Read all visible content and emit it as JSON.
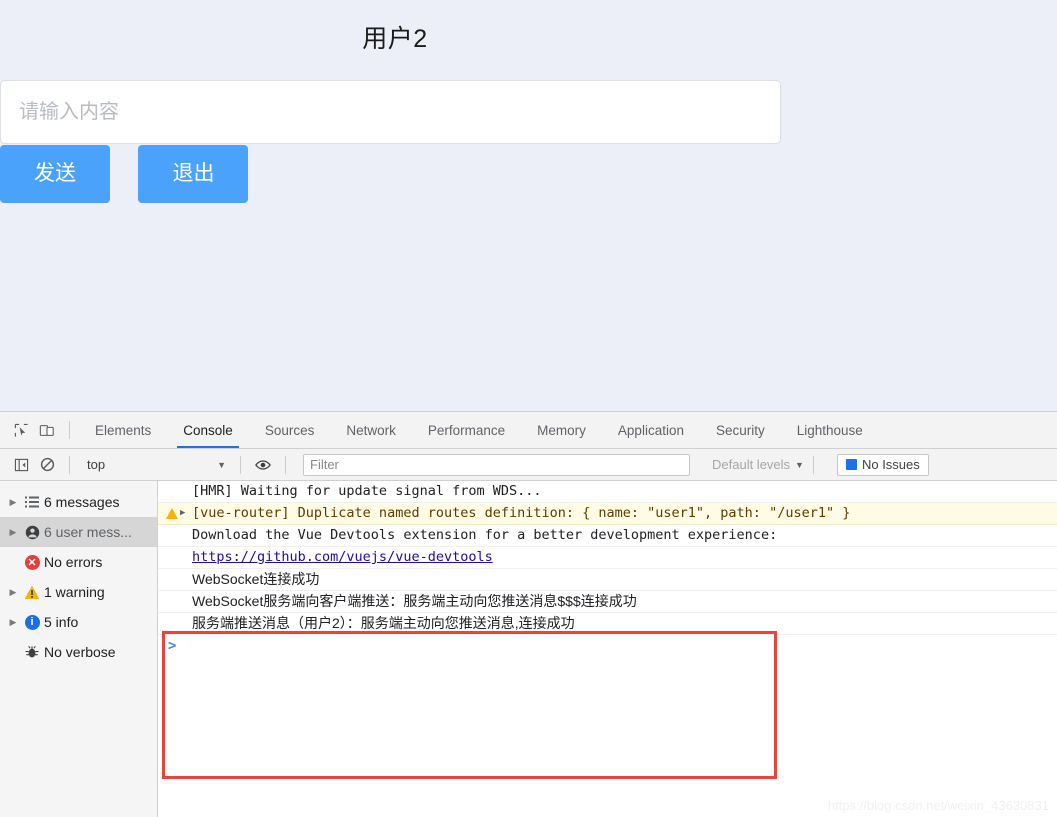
{
  "app": {
    "title": "用户2",
    "input": {
      "value": "",
      "placeholder": "请输入内容"
    },
    "send_label": "发送",
    "quit_label": "退出",
    "background_color": "#eceff8",
    "button_color": "#4ba2fb"
  },
  "devtools": {
    "icons": {
      "inspect": "inspect-cursor-icon",
      "device": "device-toolbar-icon"
    },
    "tabs": [
      {
        "label": "Elements",
        "active": false
      },
      {
        "label": "Console",
        "active": true
      },
      {
        "label": "Sources",
        "active": false
      },
      {
        "label": "Network",
        "active": false
      },
      {
        "label": "Performance",
        "active": false
      },
      {
        "label": "Memory",
        "active": false
      },
      {
        "label": "Application",
        "active": false
      },
      {
        "label": "Security",
        "active": false
      },
      {
        "label": "Lighthouse",
        "active": false
      }
    ],
    "filterbar": {
      "context": "top",
      "caret": "▼",
      "filter_placeholder": "Filter",
      "filter_value": "",
      "levels_label": "Default levels",
      "levels_caret": "▼",
      "issues_label": "No Issues",
      "eye_icon": "eye-icon",
      "sidebar_toggle_icon": "sidebar-toggle-icon",
      "clear_icon": "clear-console-icon"
    },
    "sidebar": [
      {
        "label": "6 messages",
        "icon": "list-icon",
        "tri": "▶",
        "selected": false
      },
      {
        "label": "6 user mess...",
        "icon": "user-icon",
        "tri": "▶",
        "selected": true
      },
      {
        "label": "No errors",
        "icon": "error-icon",
        "tri": "",
        "selected": false
      },
      {
        "label": "1 warning",
        "icon": "warning-icon",
        "tri": "▶",
        "selected": false
      },
      {
        "label": "5 info",
        "icon": "info-icon",
        "tri": "▶",
        "selected": false
      },
      {
        "label": "No verbose",
        "icon": "bug-icon",
        "tri": "",
        "selected": false
      }
    ],
    "messages": [
      {
        "text": "[HMR] Waiting for update signal from WDS...",
        "level": "log",
        "zh": false
      },
      {
        "text": "[vue-router] Duplicate named routes definition: { name: \"user1\", path: \"/user1\" }",
        "level": "warning",
        "zh": false,
        "disclosure": "▶"
      },
      {
        "text": "Download the Vue Devtools extension for a better development experience:",
        "level": "log",
        "zh": false
      },
      {
        "text": "https://github.com/vuejs/vue-devtools",
        "level": "log",
        "zh": false,
        "is_link": true
      },
      {
        "text": "WebSocket连接成功",
        "level": "log",
        "zh": true
      },
      {
        "text": "WebSocket服务端向客户端推送：服务端主动向您推送消息$$$连接成功",
        "level": "log",
        "zh": true
      },
      {
        "text": "服务端推送消息（用户2）：服务端主动向您推送消息,连接成功",
        "level": "log",
        "zh": true
      }
    ],
    "prompt": ">"
  },
  "annotation": {
    "box_color": "#e8443c"
  },
  "watermark": "https://blog.csdn.net/weixin_43630831"
}
